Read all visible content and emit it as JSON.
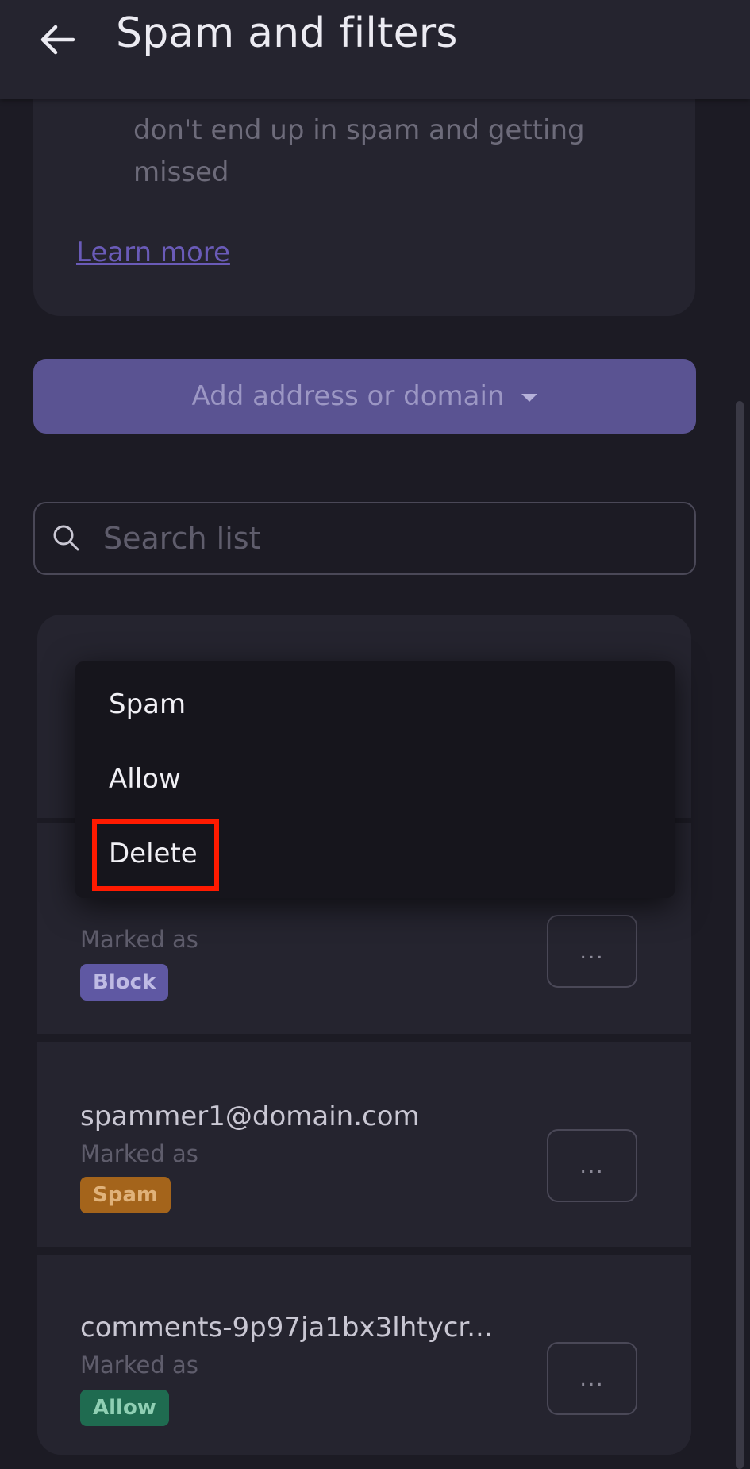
{
  "header": {
    "title": "Spam and filters",
    "back_icon": "arrow-left-icon"
  },
  "info_card": {
    "text": "don't end up in spam and getting missed",
    "learn_more": "Learn more"
  },
  "add_button": {
    "label": "Add address or domain"
  },
  "search": {
    "placeholder": "Search list",
    "value": ""
  },
  "list": {
    "marked_label": "Marked as",
    "rows": [
      {
        "address": "",
        "status": "Block",
        "more": "..."
      },
      {
        "address": "spammer1@domain.com",
        "status": "Spam",
        "more": "..."
      },
      {
        "address": "comments-9p97ja1bx3lhtycr...",
        "status": "Allow",
        "more": "..."
      }
    ]
  },
  "menu": {
    "items": [
      "Spam",
      "Allow",
      "Delete"
    ],
    "highlighted": "Delete"
  },
  "colors": {
    "block": "#5f58a3",
    "spam": "#a4641b",
    "allow": "#1f6b50",
    "highlight": "#ff1a00"
  }
}
